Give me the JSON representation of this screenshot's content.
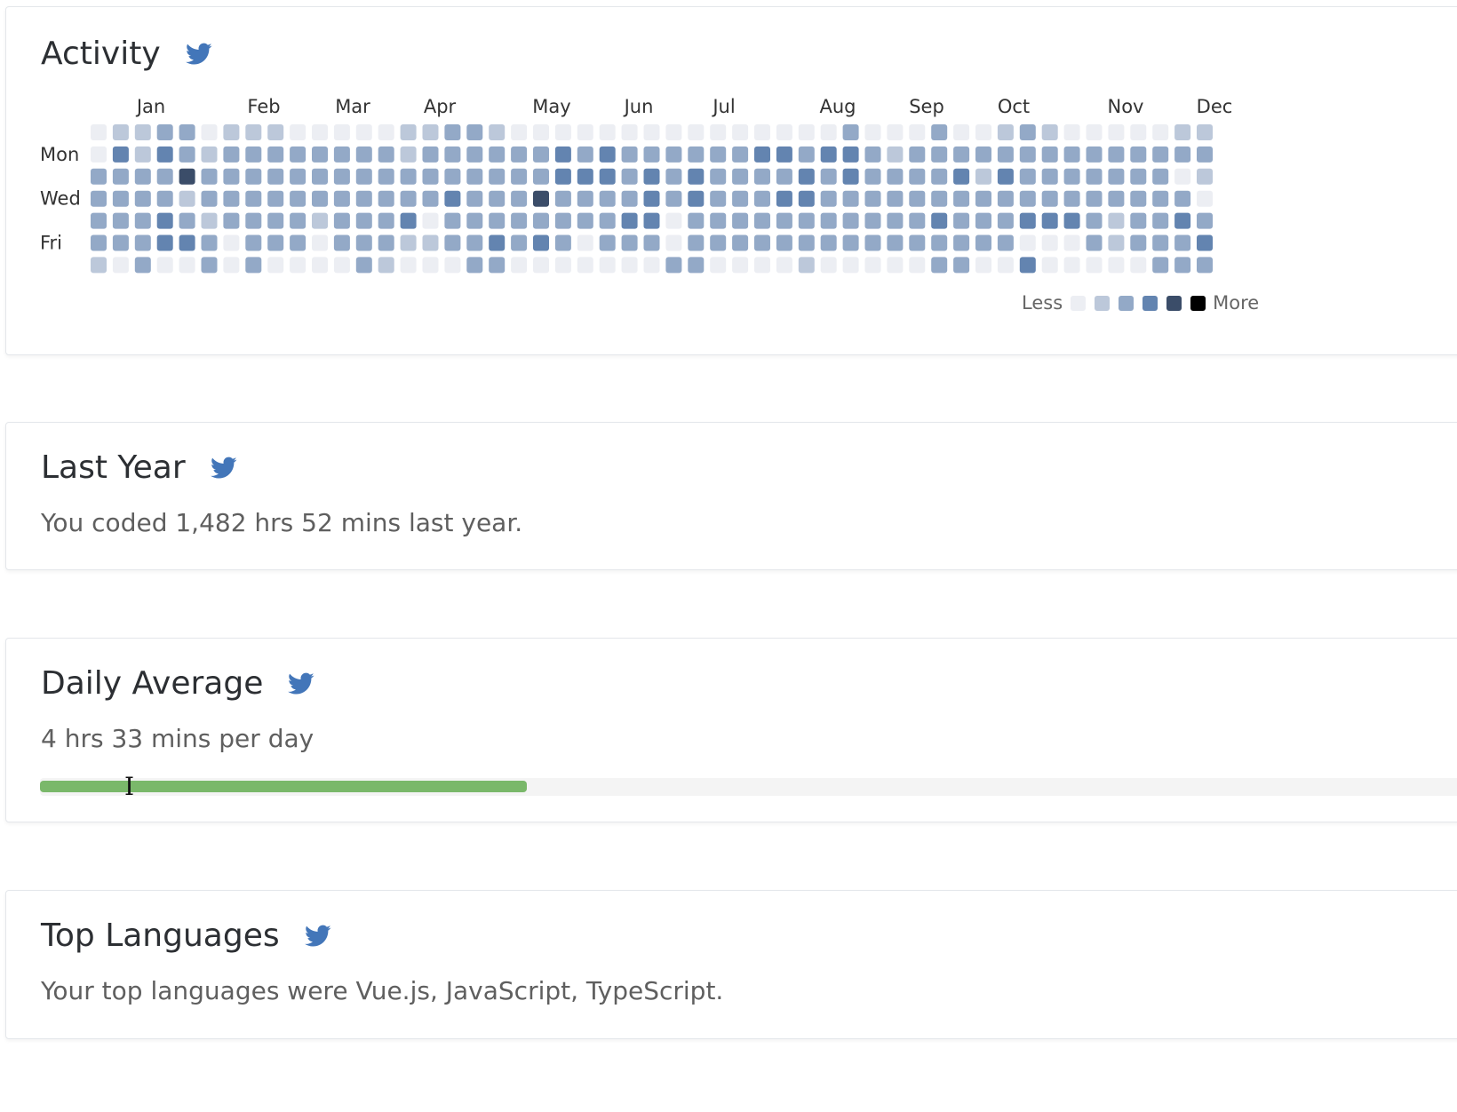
{
  "colors": {
    "levels": [
      "#eceef3",
      "#bcc8da",
      "#93a9c7",
      "#6384b0",
      "#3b4d69",
      "#000000"
    ],
    "twitter": "#4376b9",
    "progress": "#7ab86a"
  },
  "activity": {
    "title": "Activity",
    "twitter_icon": "twitter-icon",
    "months": [
      "Jan",
      "Feb",
      "Mar",
      "Apr",
      "May",
      "Jun",
      "Jul",
      "Aug",
      "Sep",
      "Oct",
      "Nov",
      "Dec"
    ],
    "days": [
      "Mon",
      "Wed",
      "Fri"
    ],
    "legend": {
      "less": "Less",
      "more": "More"
    },
    "grid": [
      "011220111000001122100000000000000020002001210000011",
      "031321222222221222222323222222332332122222222222222",
      "222242222222222222222333232322223232222313222222201",
      "222212222222222232224222232322233222222222222222220",
      "222321222212223022222222330222222222223222333212232",
      "222332022202221122323202220222222222222222000212223",
      "102002020000210002200000002200001000002200300000222"
    ]
  },
  "last_year": {
    "title": "Last Year",
    "text": "You coded 1,482 hrs 52 mins last year."
  },
  "daily_average": {
    "title": "Daily Average",
    "text": "4 hrs 33 mins per day",
    "progress_fraction": 0.33
  },
  "top_languages": {
    "title": "Top Languages",
    "text": "Your top languages were Vue.js, JavaScript, TypeScript."
  }
}
